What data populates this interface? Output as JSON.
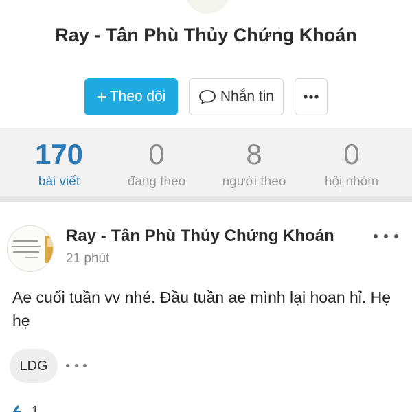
{
  "profile": {
    "name": "Ray - Tân Phù Thủy Chứng Khoán"
  },
  "actions": {
    "follow_label": "Theo dõi",
    "message_label": "Nhắn tin"
  },
  "stats": [
    {
      "value": "170",
      "label": "bài viết",
      "active": true
    },
    {
      "value": "0",
      "label": "đang theo",
      "active": false
    },
    {
      "value": "8",
      "label": "người theo",
      "active": false
    },
    {
      "value": "0",
      "label": "hội nhóm",
      "active": false
    }
  ],
  "post": {
    "author": "Ray - Tân Phù Thủy Chứng Khoán",
    "time": "21 phút",
    "body": "Ae cuối tuần vv nhé. Đầu tuần ae mình lại hoan hỉ. Hẹ hẹ",
    "tag": "LDG",
    "like_count": "1"
  },
  "colors": {
    "accent": "#1fa9e1",
    "stat_active": "#2b79b4"
  }
}
